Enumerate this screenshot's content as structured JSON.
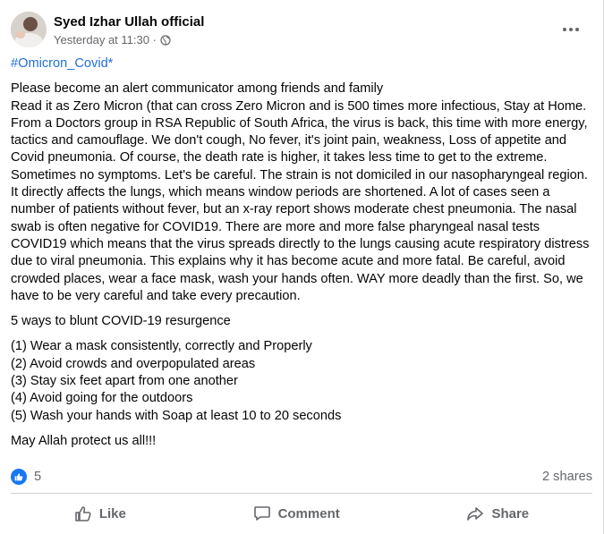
{
  "post": {
    "author": "Syed Izhar Ullah official",
    "timestamp": "Yesterday at 11:30 ·",
    "privacy_icon": "globe-icon",
    "more_icon": "more-options-icon",
    "hashtag": "#Omicron_Covid*",
    "body_paragraph": [
      "Please become an alert communicator among friends and family",
      "Read it as Zero Micron (that can cross Zero Micron and is 500 times more infectious, Stay at Home. From a Doctors group in RSA Republic of South Africa, the virus is back, this time with more energy, tactics and camouflage. We don't cough, No fever, it's joint pain, weakness, Loss of appetite and Covid pneumonia. Of course, the death rate is higher, it takes less time to get to the extreme. Sometimes no symptoms. Let's be careful. The strain is not domiciled in our nasopharyngeal region. It directly affects the lungs, which means window periods are shortened. A lot of cases seen a number of patients without fever, but an x-ray report shows moderate chest pneumonia. The nasal swab is often negative for COVID19. There are more and more false pharyngeal nasal tests COVID19 which means that the virus spreads directly to the lungs causing acute respiratory distress due to viral pneumonia. This explains why it has become acute and more fatal. Be careful, avoid crowded places, wear a face mask, wash your hands often. WAY more deadly than the first. So, we have to be very careful and take every precaution."
    ],
    "ways_heading": "5 ways to blunt COVID-19 resurgence",
    "ways": [
      "(1) Wear a mask consistently, correctly and Properly",
      "(2) Avoid crowds and overpopulated areas",
      "(3) Stay six feet apart from one another",
      "(4) Avoid going for the outdoors",
      "(5) Wash your hands with Soap at least 10 to 20 seconds"
    ],
    "closing": "May Allah protect us all!!!"
  },
  "stats": {
    "reaction_icon": "like-reaction-icon",
    "reaction_count": "5",
    "shares": "2 shares"
  },
  "actions": {
    "like": "Like",
    "comment": "Comment",
    "share": "Share"
  },
  "colors": {
    "hashtag": "#216fdb",
    "meta_text": "#65676b",
    "like_blue": "#1877f2",
    "divider": "#ced0d4"
  }
}
